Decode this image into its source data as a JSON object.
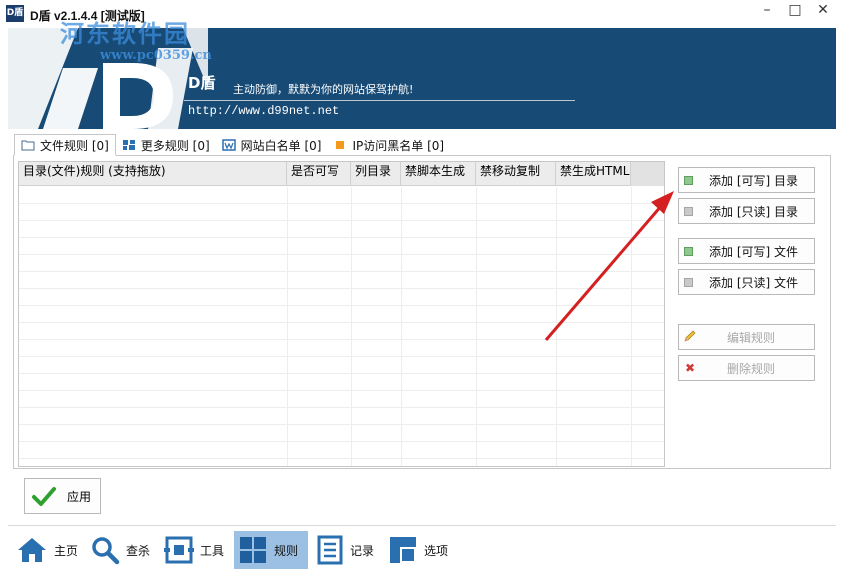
{
  "window": {
    "title": "D盾 v2.1.4.4 [测试版]",
    "icon_text": "D盾",
    "minimize_icon": "minimize-icon",
    "maximize_icon": "maximize-icon",
    "close_icon": "close-icon"
  },
  "watermark": {
    "text": "河东软件园",
    "url": "www.pc0359.cn"
  },
  "banner": {
    "brand": "D盾",
    "slogan": "主动防御，默默为你的网站保驾护航!",
    "url": "http://www.d99net.net",
    "bg_color": "#174a74"
  },
  "tabs": [
    {
      "label": "文件规则 [0]",
      "icon": "folder-icon",
      "active": true
    },
    {
      "label": "更多规则 [0]",
      "icon": "more-rules-icon",
      "active": false
    },
    {
      "label": "网站白名单 [0]",
      "icon": "whitelist-icon",
      "active": false
    },
    {
      "label": "IP访问黑名单 [0]",
      "icon": "blacklist-icon",
      "active": false
    }
  ],
  "table": {
    "columns": [
      "目录(文件)规则  (支持拖放)",
      "是否可写",
      "列目录",
      "禁脚本生成",
      "禁移动复制",
      "禁生成HTML"
    ],
    "rows": []
  },
  "side_buttons": {
    "add_writable_dir": "添加 [可写] 目录",
    "add_readonly_dir": "添加 [只读] 目录",
    "add_writable_file": "添加 [可写] 文件",
    "add_readonly_file": "添加 [只读] 文件",
    "edit_rule": "编辑规则",
    "delete_rule": "删除规则"
  },
  "apply_button": {
    "label": "应用"
  },
  "nav": [
    {
      "label": "主页",
      "icon": "home-icon",
      "active": false
    },
    {
      "label": "查杀",
      "icon": "search-icon",
      "active": false
    },
    {
      "label": "工具",
      "icon": "tools-icon",
      "active": false
    },
    {
      "label": "规则",
      "icon": "rules-grid-icon",
      "active": true
    },
    {
      "label": "记录",
      "icon": "log-icon",
      "active": false
    },
    {
      "label": "选项",
      "icon": "options-icon",
      "active": false
    }
  ],
  "colors": {
    "accent_blue": "#3c7fc4",
    "nav_active": "#9cc0e3",
    "annotation_arrow": "#d42020",
    "check_green": "#2da02d"
  }
}
